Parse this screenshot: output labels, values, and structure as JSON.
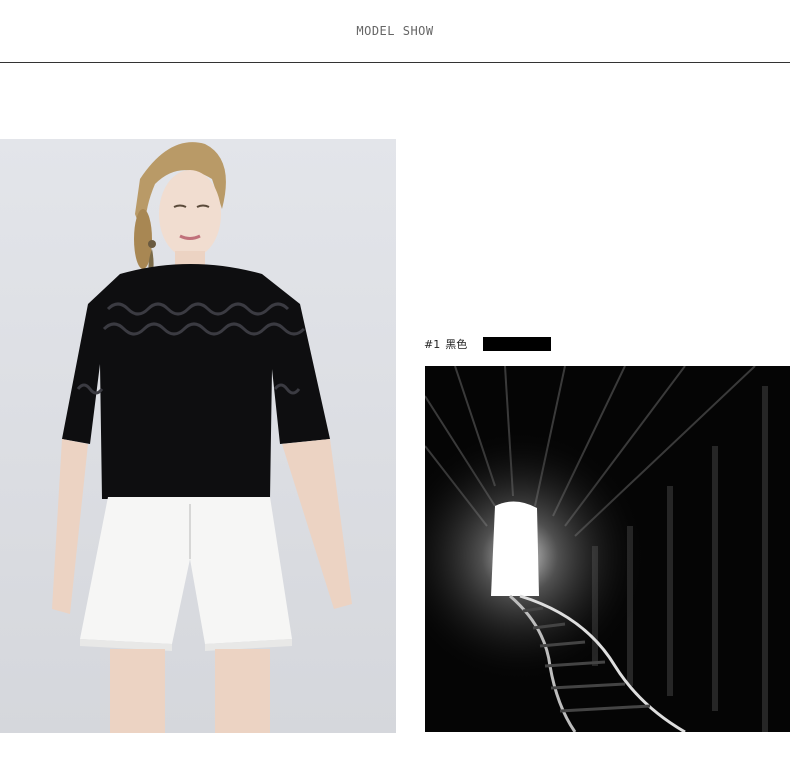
{
  "header": {
    "title": "MODEL SHOW"
  },
  "model_image": {
    "alt": "model-photo"
  },
  "color_option": {
    "code": "#1",
    "name": "黑色",
    "swatch_color": "#000000"
  },
  "tunnel_image": {
    "alt": "tunnel-photo"
  }
}
